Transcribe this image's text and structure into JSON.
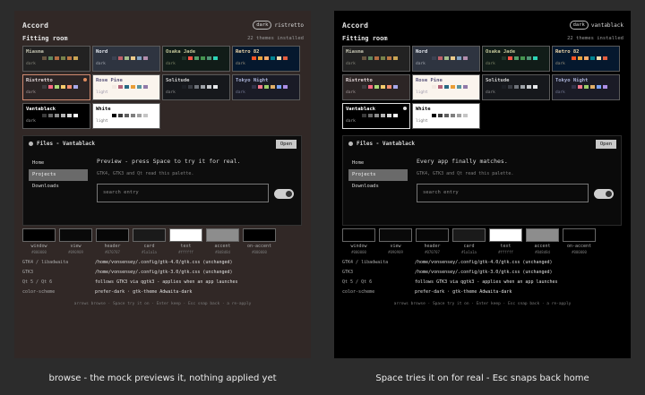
{
  "panels": [
    {
      "app_title": "Accord",
      "mode_badge": "dark",
      "theme_name": "ristretto",
      "section_title": "Fitting room",
      "themes_count": "22 themes installed",
      "themes": [
        {
          "name": "Miasma",
          "mode": "dark",
          "bg": "#222222",
          "fg": "#c2c2b0",
          "swatches": [
            "#685742",
            "#5f875f",
            "#b36d43",
            "#78824b",
            "#bb7744",
            "#c9a554"
          ]
        },
        {
          "name": "Nord",
          "mode": "dark",
          "bg": "#2e3440",
          "fg": "#e5e9f0",
          "swatches": [
            "#3b4252",
            "#bf616a",
            "#a3be8c",
            "#ebcb8b",
            "#81a1c1",
            "#b48ead"
          ]
        },
        {
          "name": "Osaka Jade",
          "mode": "dark",
          "bg": "#111c18",
          "fg": "#c1c497",
          "swatches": [
            "#23372b",
            "#ff5345",
            "#549e6a",
            "#459451",
            "#509475",
            "#2dd5b7"
          ]
        },
        {
          "name": "Retro 82",
          "mode": "dark",
          "bg": "#05182e",
          "fg": "#f6dcac",
          "swatches": [
            "#f85525",
            "#e8a43c",
            "#faa968",
            "#028391",
            "#f6dcac",
            "#e55e3f"
          ]
        },
        {
          "name": "Ristretto",
          "mode": "dark",
          "bg": "#2c2525",
          "fg": "#e6d9db",
          "swatches": [
            "#403e41",
            "#fd6883",
            "#adda78",
            "#f9cc6c",
            "#f38d70",
            "#a8a9eb"
          ]
        },
        {
          "name": "Rose Pine",
          "mode": "light",
          "bg": "#faf4ed",
          "fg": "#575279",
          "swatches": [
            "#f2e9e1",
            "#b4637a",
            "#286983",
            "#ea9d34",
            "#56949f",
            "#907aa9"
          ]
        },
        {
          "name": "Solitude",
          "mode": "dark",
          "bg": "#16181c",
          "fg": "#d0d0d0",
          "swatches": [
            "#1d2026",
            "#3a3d44",
            "#6f737a",
            "#9ea2a8",
            "#c6c9cd",
            "#e8eaed"
          ]
        },
        {
          "name": "Tokyo Night",
          "mode": "dark",
          "bg": "#1a1b26",
          "fg": "#a9b1d6",
          "swatches": [
            "#32344a",
            "#f7768e",
            "#9ece6a",
            "#e0af68",
            "#7aa2f7",
            "#ad8ee6"
          ]
        },
        {
          "name": "Vantablack",
          "mode": "dark",
          "bg": "#000000",
          "fg": "#ffffff",
          "swatches": [
            "#3a3a3a",
            "#6a6a6a",
            "#8d8d8d",
            "#b5b5b5",
            "#dadada",
            "#ffffff"
          ]
        },
        {
          "name": "White",
          "mode": "light",
          "bg": "#ffffff",
          "fg": "#000000",
          "swatches": [
            "#000000",
            "#3a3a3a",
            "#5f5f5f",
            "#7f7f7f",
            "#a0a0a0",
            "#c5c5c5"
          ]
        }
      ],
      "preview": {
        "title": "Files - Vantablack",
        "open_label": "Open",
        "sidebar": [
          "Home",
          "Projects",
          "Downloads"
        ],
        "heading": "Preview - press Space to try it for real.",
        "subtext": "GTK4, GTK3 and Qt read this palette.",
        "search_placeholder": "search entry"
      },
      "chips": [
        {
          "label": "window",
          "hex": "#000000",
          "color": "#000000"
        },
        {
          "label": "view",
          "hex": "#090909",
          "color": "#090909"
        },
        {
          "label": "header",
          "hex": "#070707",
          "color": "#070707"
        },
        {
          "label": "card",
          "hex": "#1a1a1a",
          "color": "#1a1a1a"
        },
        {
          "label": "text",
          "hex": "#ffffff",
          "color": "#ffffff"
        },
        {
          "label": "accent",
          "hex": "#8d8d8d",
          "color": "#8d8d8d"
        },
        {
          "label": "on-accent",
          "hex": "#000000",
          "color": "#000000"
        }
      ],
      "info": [
        {
          "key": "GTK4 / libadwaita",
          "value": "/home/vonsensey/.config/gtk-4.0/gtk.css  (unchanged)"
        },
        {
          "key": "GTK3",
          "value": "/home/vonsensey/.config/gtk-3.0/gtk.css  (unchanged)"
        },
        {
          "key": "Qt 5 / Qt 6",
          "value": "follows GTK3 via qgtk3 - applies when an app launches"
        },
        {
          "key": "color-scheme",
          "value": "prefer-dark  ·  gtk-theme Adwaita-dark"
        }
      ],
      "keys_hint": "arrows browse  ·  Space try it on  ·  Enter keep  ·  Esc snap back  ·  a re-apply",
      "caption": "browse - the mock previews it, nothing applied yet"
    },
    {
      "app_title": "Accord",
      "mode_badge": "dark",
      "theme_name": "vantablack",
      "section_title": "Fitting room",
      "themes_count": "22 themes installed",
      "caption": "Space tries it on for real - Esc snaps back home"
    }
  ],
  "accent_left": "#312826",
  "accent_right": "#000000"
}
